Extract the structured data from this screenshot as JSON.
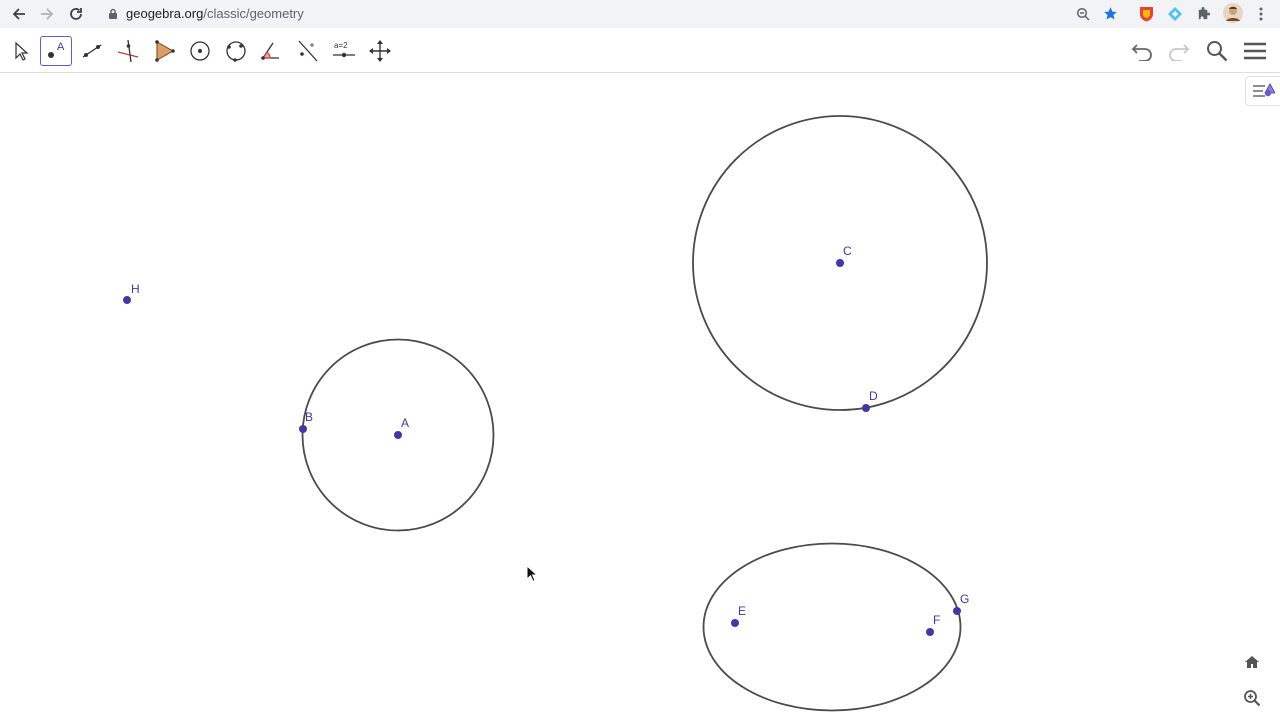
{
  "browser": {
    "url_domain": "geogebra.org",
    "url_path": "/classic/geometry"
  },
  "toolbar": {
    "tools": [
      {
        "name": "move-tool",
        "icon": "arrow-pointer-icon",
        "active": false
      },
      {
        "name": "point-tool",
        "icon": "point-icon",
        "active": true,
        "label": "A"
      },
      {
        "name": "segment-tool",
        "icon": "segment-icon",
        "active": false
      },
      {
        "name": "perpendicular-line-tool",
        "icon": "perpendicular-icon",
        "active": false
      },
      {
        "name": "polygon-tool",
        "icon": "polygon-icon",
        "active": false
      },
      {
        "name": "circle-center-point-tool",
        "icon": "circle-center-icon",
        "active": false
      },
      {
        "name": "circle-three-points-tool",
        "icon": "circle-three-points-icon",
        "active": false
      },
      {
        "name": "angle-tool",
        "icon": "angle-icon",
        "active": false
      },
      {
        "name": "reflect-tool",
        "icon": "reflect-icon",
        "active": false
      },
      {
        "name": "slider-tool",
        "icon": "slider-icon",
        "active": false,
        "label": "a=2"
      },
      {
        "name": "move-view-tool",
        "icon": "move-view-icon",
        "active": false
      }
    ],
    "right": [
      "undo-icon",
      "redo-icon",
      "search-icon",
      "menu-icon"
    ]
  },
  "canvas": {
    "point_color": "#4137a8",
    "stroke_color": "#4b4b4b",
    "points": [
      {
        "label": "H"
      },
      {
        "label": "B"
      },
      {
        "label": "A"
      },
      {
        "label": "C"
      },
      {
        "label": "D"
      },
      {
        "label": "E"
      },
      {
        "label": "F"
      },
      {
        "label": "G"
      }
    ]
  }
}
